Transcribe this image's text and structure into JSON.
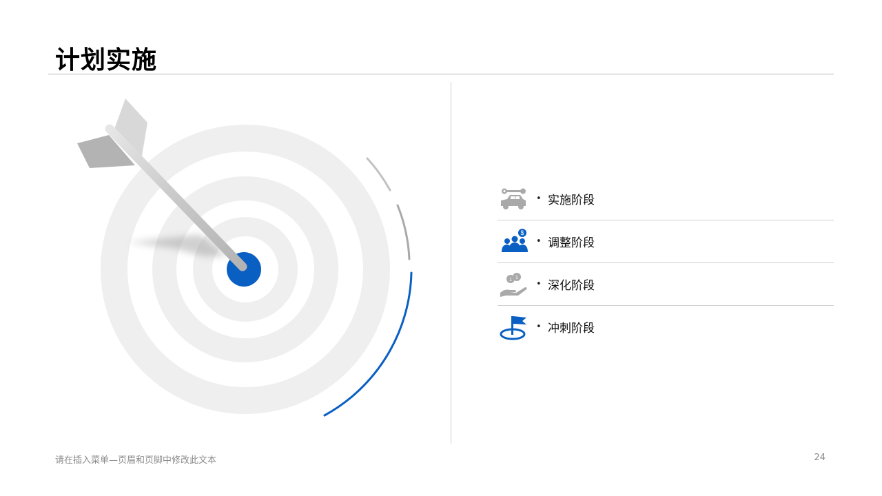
{
  "page": {
    "title": "计划实施",
    "footer_text": "请在插入菜单—页眉和页脚中修改此文本",
    "page_number": "24"
  },
  "colors": {
    "accent": "#0a5fc2",
    "gray_icon": "#a9a9a9",
    "ring": "#efefef"
  },
  "stages": [
    {
      "label": "实施阶段",
      "bullet": "•",
      "icon": "car-repair-icon"
    },
    {
      "label": "调整阶段",
      "bullet": "•",
      "icon": "team-money-icon"
    },
    {
      "label": "深化阶段",
      "bullet": "•",
      "icon": "coins-hand-icon"
    },
    {
      "label": "冲刺阶段",
      "bullet": "•",
      "icon": "flag-target-icon"
    }
  ]
}
